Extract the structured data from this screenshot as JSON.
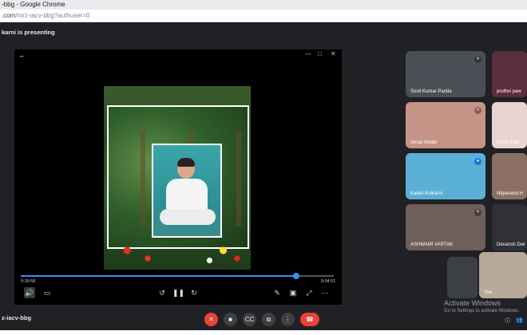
{
  "browser": {
    "title": "-bbg - Google Chrome",
    "url_prefix": ".com",
    "url_path": "/mrz-iacv-bbg?authuser=0"
  },
  "meet": {
    "presenting_text": "karni is presenting",
    "meeting_code": "z-iacv-bbg"
  },
  "player": {
    "back_icon": "arrow-left-icon",
    "time_current": "0:39:58",
    "time_total": "0:04:51",
    "progress_fraction": 0.88
  },
  "participants": [
    {
      "name": "Sovit Kumar Parida",
      "bg": "#4a4f55"
    },
    {
      "name": "pruthvi paw",
      "bg": "#5b2e3c"
    },
    {
      "name": "Arnav Kedar",
      "bg": "#c69487"
    },
    {
      "name": "Ritvik Patil",
      "bg": "#e8d4d0"
    },
    {
      "name": "Kalani Kolkarni",
      "bg": "#5bb0d6"
    },
    {
      "name": "Nityanand H",
      "bg": "#8c6f64"
    },
    {
      "name": "ASHWAMI VARTAK",
      "bg": "#6f5e5a"
    },
    {
      "name": "Devansh Dwi",
      "bg": "#2f3134"
    },
    {
      "name": "You",
      "bg": "#b7a89a"
    }
  ],
  "system_watermark": {
    "line1": "Activate Windows",
    "line2": "Go to Settings to activate Windows."
  },
  "colors": {
    "leave_red": "#ea4335",
    "progress_blue": "#3c8ff0"
  }
}
